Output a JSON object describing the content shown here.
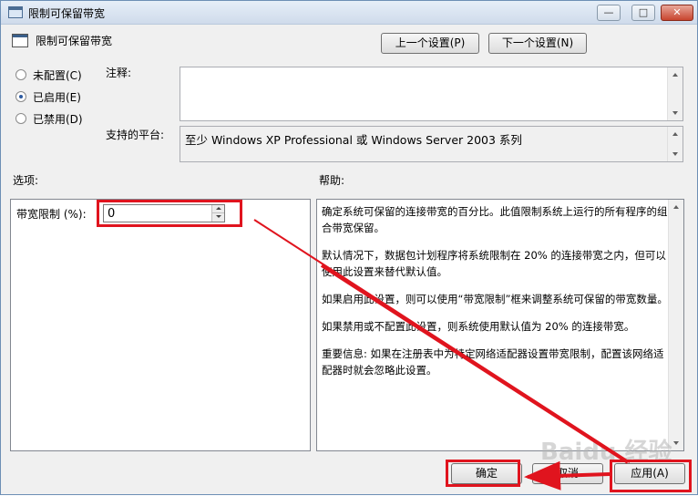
{
  "window": {
    "title": "限制可保留带宽",
    "controls": {
      "minimize": "—",
      "maximize": "□",
      "close": "✕"
    }
  },
  "header": {
    "title": "限制可保留带宽",
    "prev_button": "上一个设置(P)",
    "next_button": "下一个设置(N)"
  },
  "state": {
    "options": [
      {
        "label": "未配置(C)",
        "checked": false
      },
      {
        "label": "已启用(E)",
        "checked": true
      },
      {
        "label": "已禁用(D)",
        "checked": false
      }
    ]
  },
  "comment": {
    "label": "注释:",
    "value": ""
  },
  "platform": {
    "label": "支持的平台:",
    "value": "至少 Windows XP Professional 或 Windows Server 2003 系列"
  },
  "options_section": {
    "label": "选项:",
    "bandwidth_label": "带宽限制 (%):",
    "bandwidth_value": "0"
  },
  "help_section": {
    "label": "帮助:",
    "paragraphs": [
      "确定系统可保留的连接带宽的百分比。此值限制系统上运行的所有程序的组合带宽保留。",
      "默认情况下，数据包计划程序将系统限制在 20% 的连接带宽之内，但可以使用此设置来替代默认值。",
      "如果启用此设置，则可以使用“带宽限制”框来调整系统可保留的带宽数量。",
      "如果禁用或不配置此设置，则系统使用默认值为 20% 的连接带宽。",
      "重要信息: 如果在注册表中为特定网络适配器设置带宽限制，配置该网络适配器时就会忽略此设置。"
    ]
  },
  "footer": {
    "ok_button": "确定",
    "cancel_button": "取消",
    "apply_button": "应用(A)"
  },
  "annotation_color": "#e0141e",
  "watermark": "Baidu 经验"
}
